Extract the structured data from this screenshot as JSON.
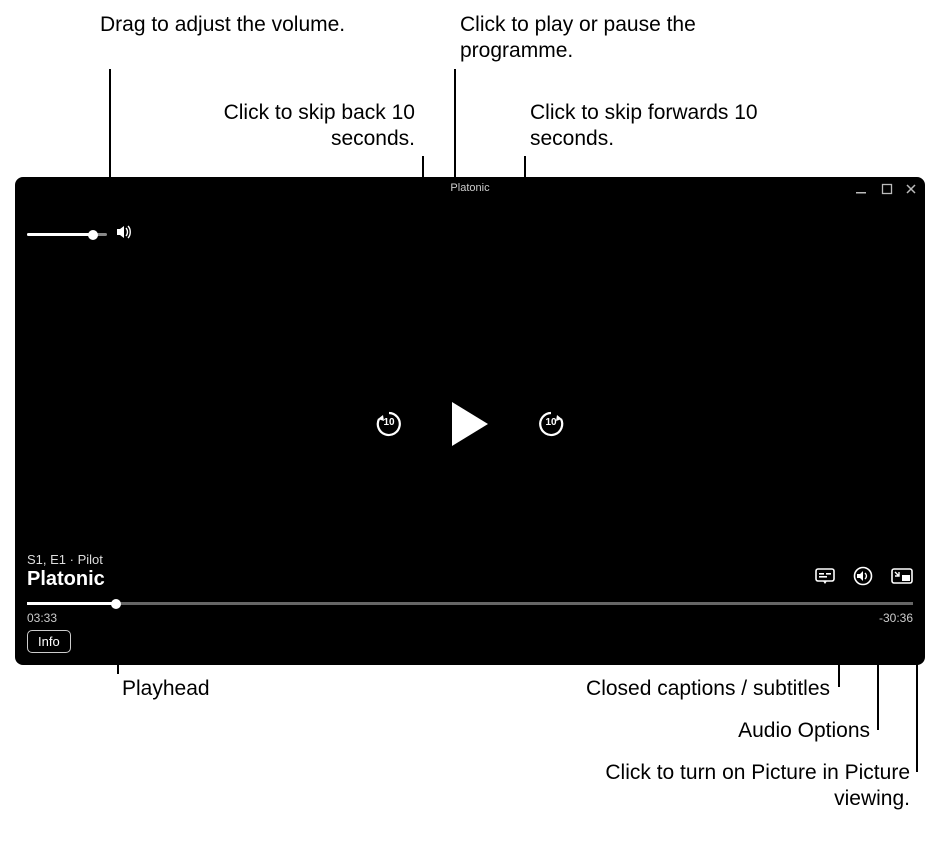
{
  "callouts": {
    "volume": "Drag to adjust the volume.",
    "skip_back": "Click to skip back 10 seconds.",
    "play_pause": "Click to play or pause the programme.",
    "skip_fwd": "Click to skip forwards 10 seconds.",
    "playhead": "Playhead",
    "cc": "Closed captions / subtitles",
    "audio": "Audio Options",
    "pip": "Click to turn on Picture in Picture viewing."
  },
  "player": {
    "window_title": "Platonic",
    "skip_back_label": "10",
    "skip_fwd_label": "10",
    "episode_meta": "S1, E1 · Pilot",
    "title": "Platonic",
    "elapsed": "03:33",
    "remaining": "-30:36",
    "info_button": "Info",
    "volume_percent": 82,
    "progress_percent": 10
  }
}
